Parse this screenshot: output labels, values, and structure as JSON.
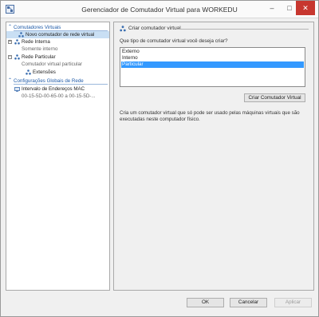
{
  "window": {
    "title": "Gerenciador de Comutador Virtual para WORKEDU",
    "minimize": "–",
    "maximize": "□",
    "close": "✕",
    "icon": "hyper-v-manager-icon"
  },
  "tree": {
    "virtual_switches_header": "Comutadores Virtuais",
    "new_switch": "Novo comutador de rede virtual",
    "internal_network": "Rede Interna",
    "internal_network_sub": "Somente interno",
    "private_network": "Rede Particular",
    "private_network_sub": "Comutador virtual particular",
    "extensions": "Extensões",
    "global_header": "Configurações Globais de Rede",
    "mac_range": "Intervalo de Endereços MAC",
    "mac_range_sub": "00-15-5D-00-65-00 a 00-15-5D-..."
  },
  "main": {
    "group_title": "Criar comutador virtual",
    "question": "Que tipo de comutador virtual você deseja criar?",
    "options": [
      "Externo",
      "Interno",
      "Particular"
    ],
    "selected_option": "Particular",
    "create_button": "Criar Comutador Virtual",
    "description": "Cria um comutador virtual que só pode ser usado pelas máquinas virtuais que são executadas neste computador físico."
  },
  "footer": {
    "ok": "OK",
    "cancel": "Cancelar",
    "apply": "Aplicar"
  },
  "colors": {
    "header_blue": "#1e5aa8",
    "selection_blue": "#3399ff",
    "tree_selection": "#c9dff4",
    "close_red": "#c7372f"
  }
}
